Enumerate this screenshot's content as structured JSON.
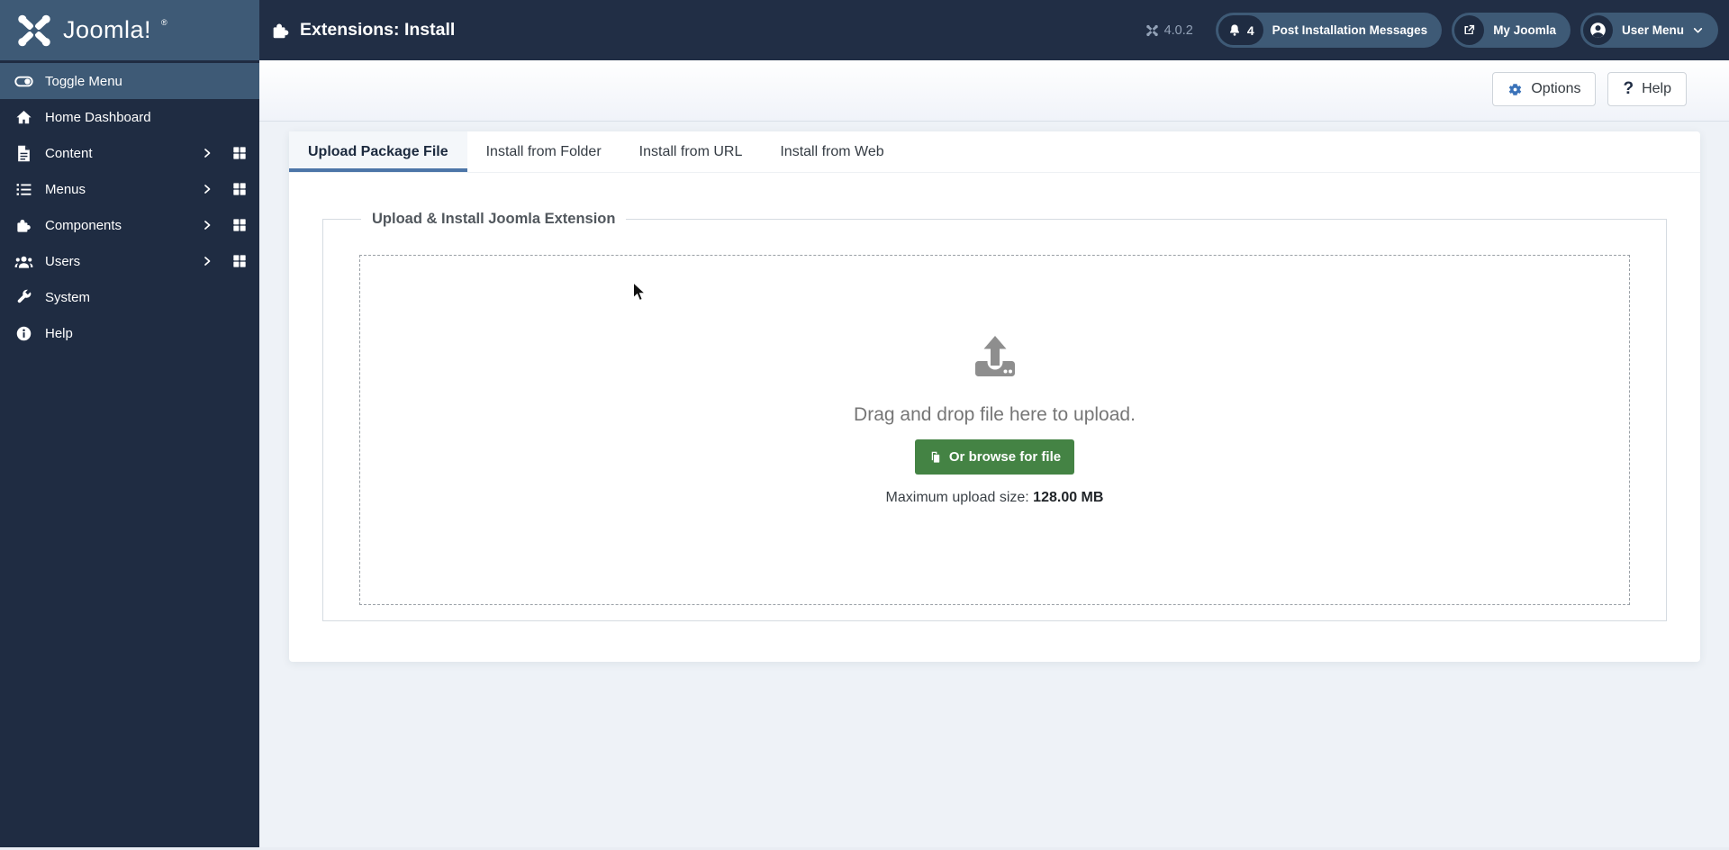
{
  "header": {
    "logo_text": "Joomla!",
    "logo_reg": "®",
    "title": "Extensions: Install",
    "version": "4.0.2",
    "notifications_count": "4",
    "post_installation_label": "Post Installation Messages",
    "my_joomla_label": "My Joomla",
    "user_menu_label": "User Menu"
  },
  "sidebar": {
    "items": [
      {
        "label": "Toggle Menu",
        "icon": "toggle-icon",
        "active": true,
        "has_submenu": false
      },
      {
        "label": "Home Dashboard",
        "icon": "home-icon",
        "active": false,
        "has_submenu": false
      },
      {
        "label": "Content",
        "icon": "file-icon",
        "active": false,
        "has_submenu": true
      },
      {
        "label": "Menus",
        "icon": "list-icon",
        "active": false,
        "has_submenu": true
      },
      {
        "label": "Components",
        "icon": "puzzle-icon",
        "active": false,
        "has_submenu": true
      },
      {
        "label": "Users",
        "icon": "users-icon",
        "active": false,
        "has_submenu": true
      },
      {
        "label": "System",
        "icon": "wrench-icon",
        "active": false,
        "has_submenu": false
      },
      {
        "label": "Help",
        "icon": "info-icon",
        "active": false,
        "has_submenu": false
      }
    ]
  },
  "toolbar": {
    "options_label": "Options",
    "help_label": "Help"
  },
  "tabs": [
    {
      "label": "Upload Package File",
      "active": true
    },
    {
      "label": "Install from Folder",
      "active": false
    },
    {
      "label": "Install from URL",
      "active": false
    },
    {
      "label": "Install from Web",
      "active": false
    }
  ],
  "upload": {
    "legend": "Upload & Install Joomla Extension",
    "drag_text": "Drag and drop file here to upload.",
    "browse_label": "Or browse for file",
    "max_size_label": "Maximum upload size:",
    "max_size_value": "128.00 MB"
  },
  "colors": {
    "header_bg": "#212e45",
    "sidebar_bg": "#1f2c42",
    "accent_blue": "#3e5a76",
    "tab_underline": "#4d76a8",
    "success_green": "#448344",
    "content_bg": "#eef2f7",
    "gear_blue": "#3a72b9"
  }
}
